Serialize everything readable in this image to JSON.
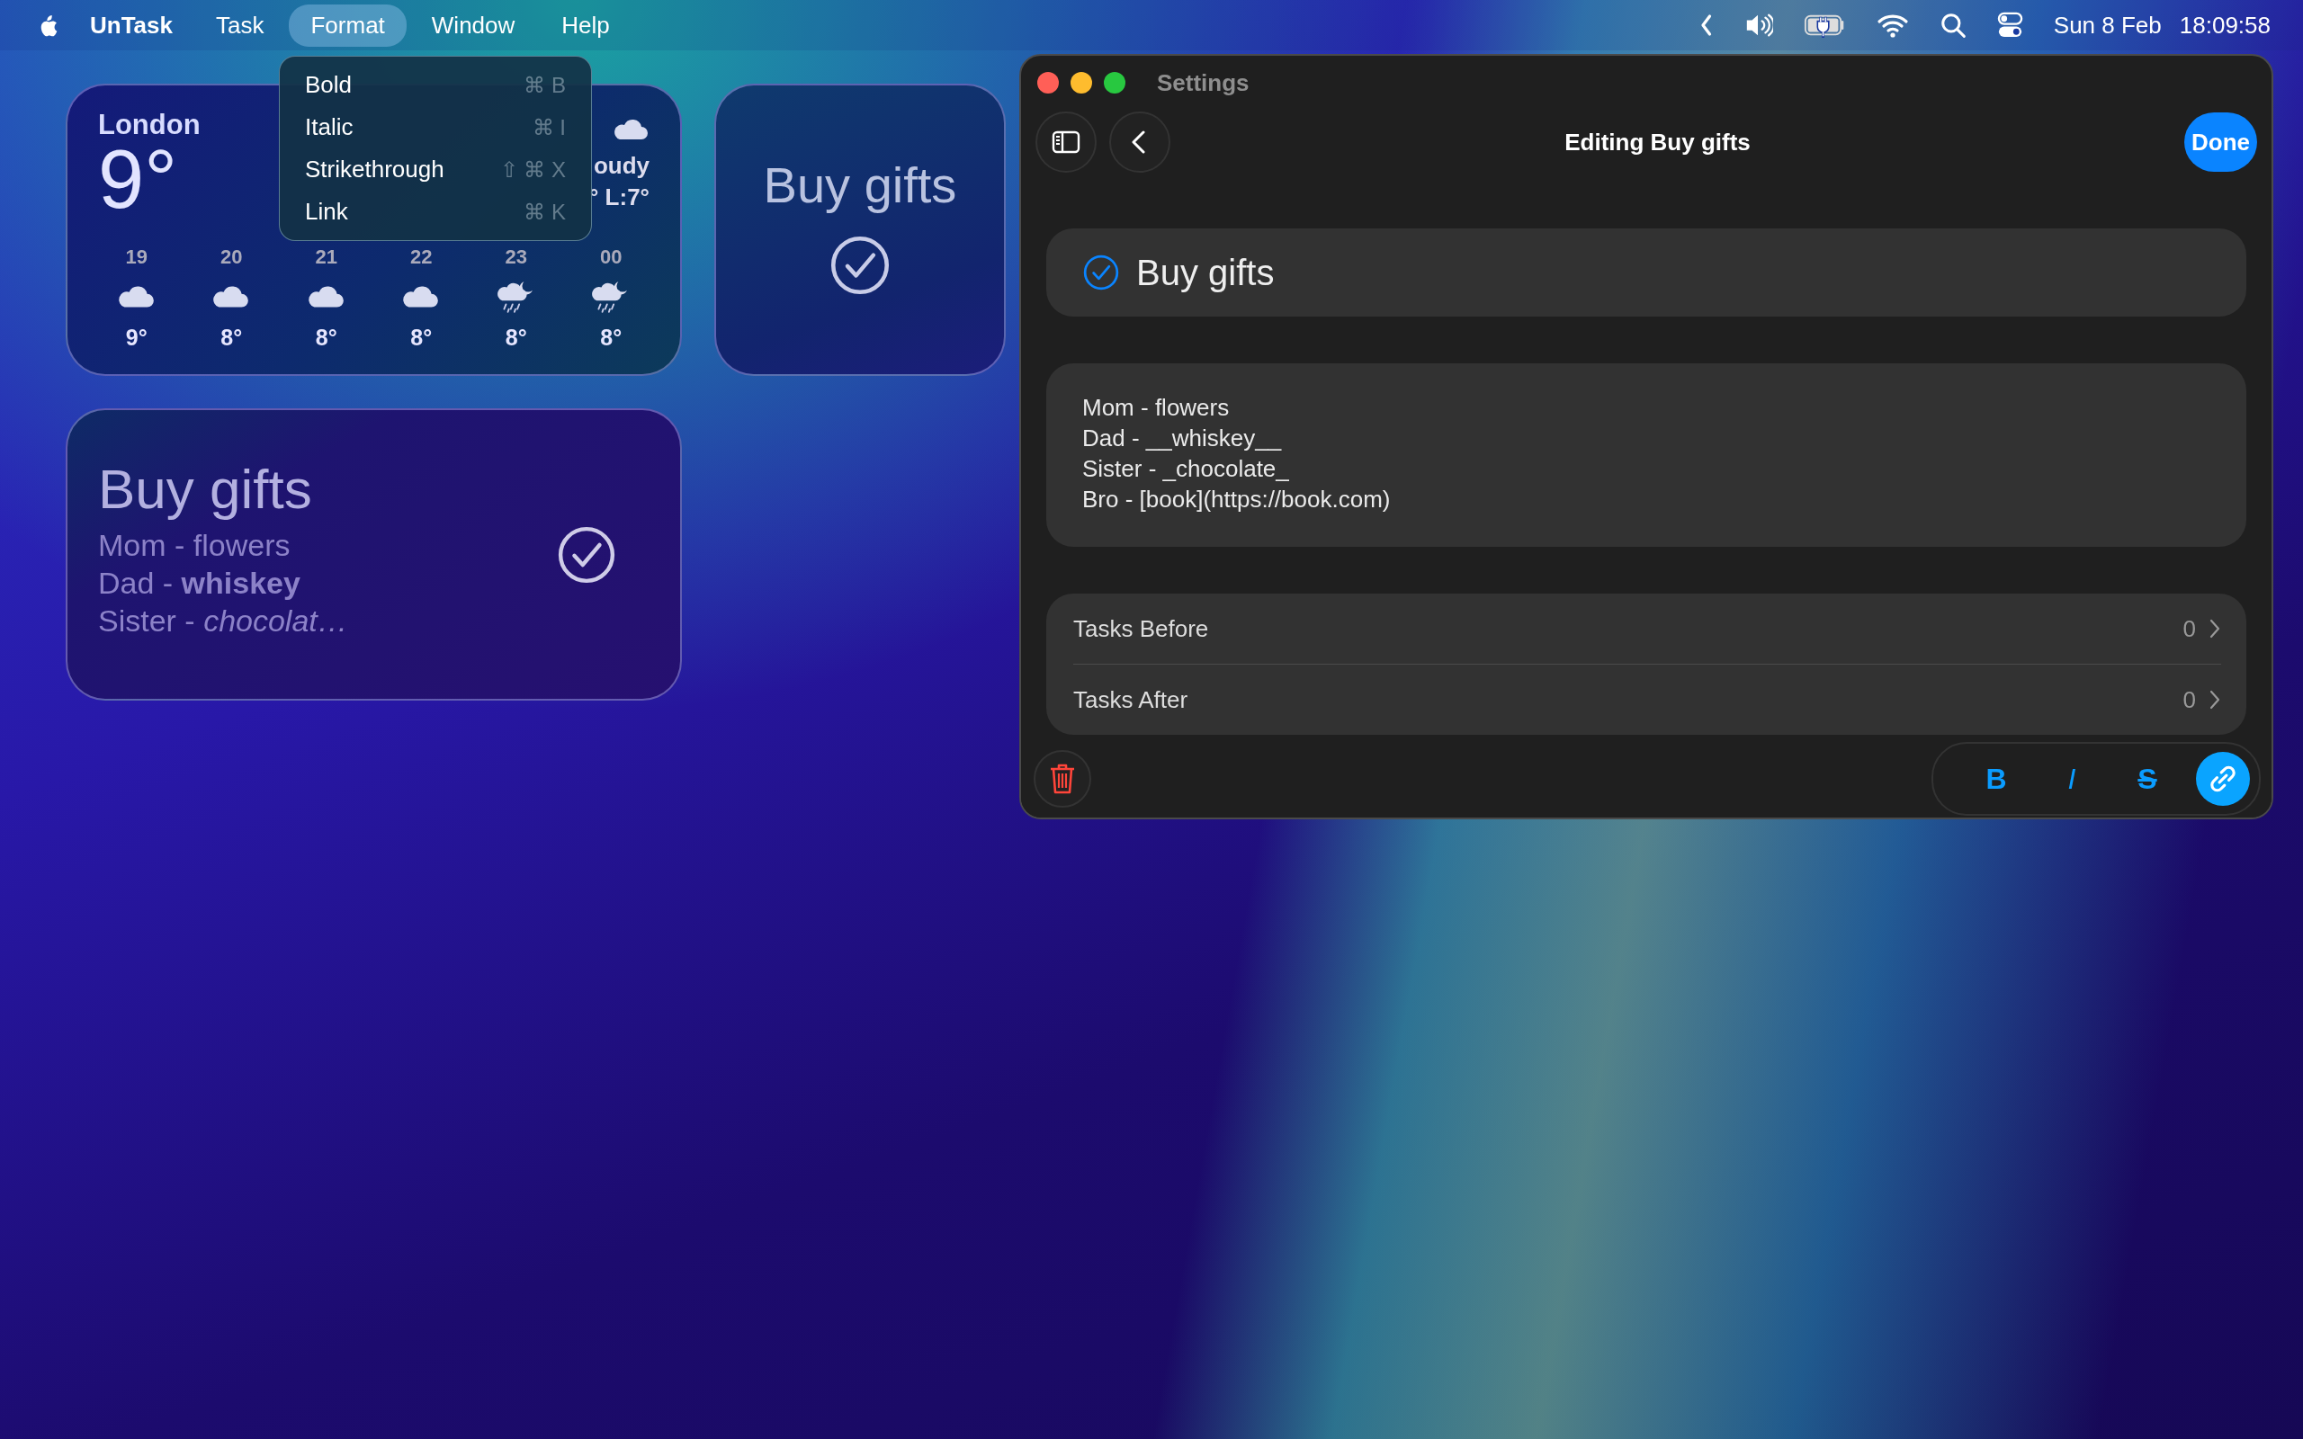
{
  "menu_bar": {
    "app_name": "UnTask",
    "menus": [
      {
        "label": "Task",
        "selected": false
      },
      {
        "label": "Format",
        "selected": true
      },
      {
        "label": "Window",
        "selected": false
      },
      {
        "label": "Help",
        "selected": false
      }
    ],
    "date": "Sun 8 Feb",
    "time": "18:09:58"
  },
  "format_menu": {
    "items": [
      {
        "label": "Bold",
        "shortcut": "⌘ B"
      },
      {
        "label": "Italic",
        "shortcut": "⌘ I"
      },
      {
        "label": "Strikethrough",
        "shortcut": "⇧ ⌘ X"
      },
      {
        "label": "Link",
        "shortcut": "⌘ K"
      }
    ]
  },
  "weather_widget": {
    "city": "London",
    "temperature": "9°",
    "condition": "oudy",
    "range": "° L:7°",
    "hours": [
      {
        "time": "19",
        "kind": "cloudy",
        "temperature": "9°"
      },
      {
        "time": "20",
        "kind": "cloudy",
        "temperature": "8°"
      },
      {
        "time": "21",
        "kind": "cloudy",
        "temperature": "8°"
      },
      {
        "time": "22",
        "kind": "cloudy",
        "temperature": "8°"
      },
      {
        "time": "23",
        "kind": "rain-night",
        "temperature": "8°"
      },
      {
        "time": "00",
        "kind": "rain-night",
        "temperature": "8°"
      }
    ]
  },
  "task_widget_small": {
    "title": "Buy gifts",
    "completed": true
  },
  "task_widget_large": {
    "title": "Buy gifts",
    "lines": [
      "Mom - flowers",
      "Dad - **whiskey**",
      "Sister - *chocolat…*"
    ],
    "completed": true
  },
  "settings_window": {
    "title": "Settings",
    "heading": "Editing Buy gifts",
    "done_button": "Done",
    "task": {
      "title": "Buy gifts",
      "completed": true
    },
    "notes": "Mom - flowers\nDad - __whiskey__\nSister - _chocolate_\nBro - [book](https://book.com)",
    "links": [
      {
        "label": "Tasks Before",
        "count": "0"
      },
      {
        "label": "Tasks After",
        "count": "0"
      }
    ],
    "format_buttons": [
      {
        "kind": "bold",
        "label": "B",
        "selected": false
      },
      {
        "kind": "italic",
        "label": "I",
        "selected": false
      },
      {
        "kind": "strike",
        "label": "S",
        "selected": false
      },
      {
        "kind": "link",
        "selected": true
      }
    ]
  }
}
